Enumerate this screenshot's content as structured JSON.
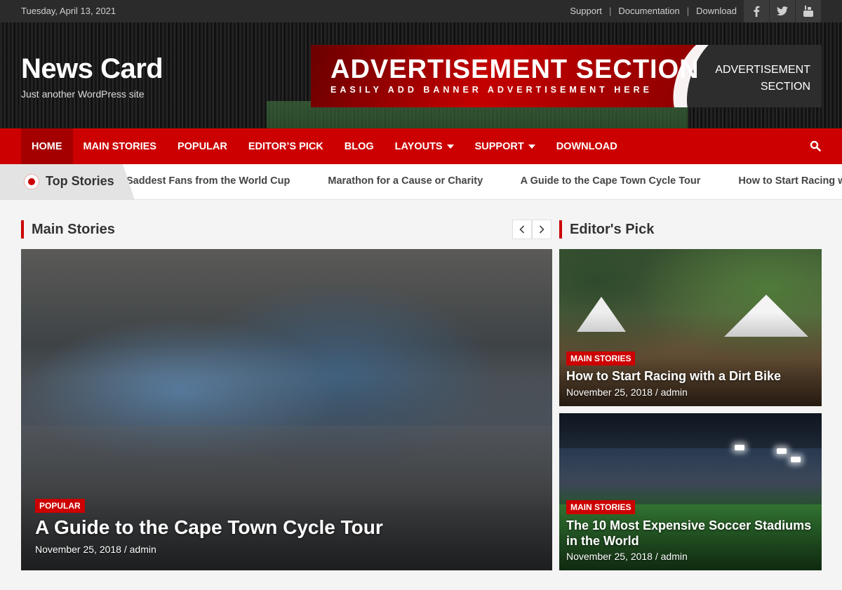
{
  "topbar": {
    "date": "Tuesday, April 13, 2021",
    "links": [
      "Support",
      "Documentation",
      "Download"
    ],
    "social": [
      "facebook-icon",
      "twitter-icon",
      "youtube-icon"
    ]
  },
  "site": {
    "title": "News Card",
    "tagline": "Just another WordPress site"
  },
  "ad": {
    "headline": "ADVERTISEMENT SECTION",
    "subline": "EASILY ADD BANNER ADVERTISEMENT HERE",
    "side_line1": "ADVERTISEMENT",
    "side_line2": "SECTION"
  },
  "nav": {
    "items": [
      {
        "label": "HOME"
      },
      {
        "label": "MAIN STORIES"
      },
      {
        "label": "POPULAR"
      },
      {
        "label": "EDITOR’S PICK"
      },
      {
        "label": "BLOG"
      },
      {
        "label": "LAYOUTS"
      },
      {
        "label": "SUPPORT"
      },
      {
        "label": "DOWNLOAD"
      }
    ],
    "active": "HOME"
  },
  "ticker": {
    "label": "Top Stories",
    "items": [
      "Saddest Fans from the World Cup",
      "Marathon for a Cause or Charity",
      "A Guide to the Cape Town Cycle Tour",
      "How to Start Racing with a Dirt Bike"
    ]
  },
  "main_stories": {
    "heading": "Main Stories",
    "featured": {
      "category": "POPULAR",
      "title": "A Guide to the Cape Town Cycle Tour",
      "meta": "November 25, 2018 / admin"
    }
  },
  "editors_pick": {
    "heading": "Editor's Pick",
    "posts": [
      {
        "category": "MAIN STORIES",
        "title": "How to Start Racing with a Dirt Bike",
        "meta": "November 25, 2018 / admin"
      },
      {
        "category": "MAIN STORIES",
        "title": "The 10 Most Expensive Soccer Stadiums in the World",
        "meta": "November 25, 2018 / admin"
      }
    ]
  },
  "colors": {
    "accent": "#cc0000",
    "topbar": "#2b2b2b"
  }
}
